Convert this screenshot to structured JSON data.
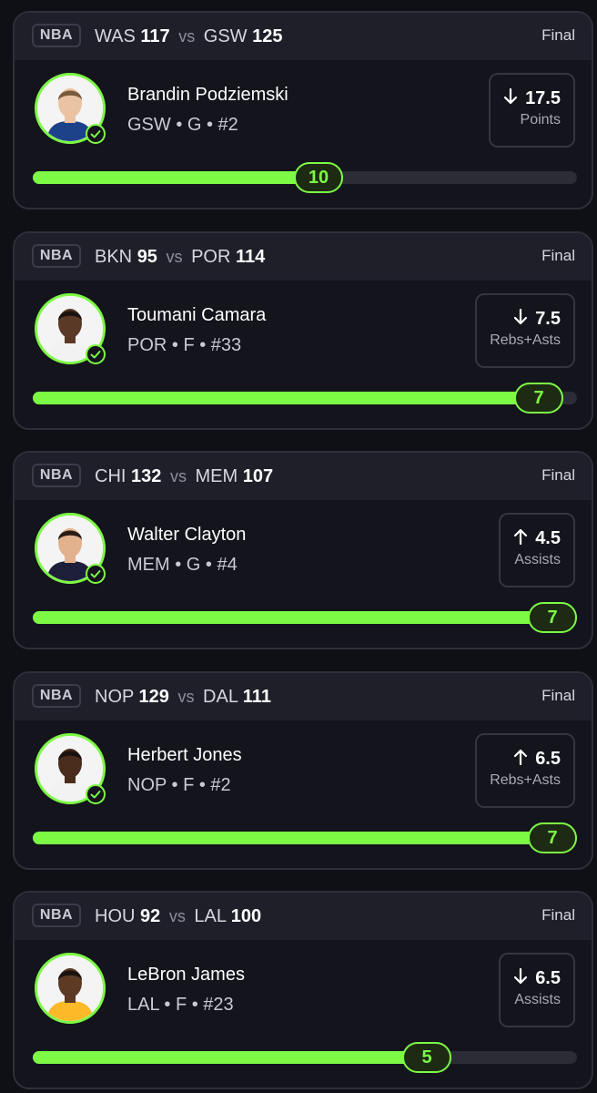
{
  "colors": {
    "accent": "#7dfa45",
    "background": "#0f1016",
    "card": "#13141c",
    "header": "#1e1f29"
  },
  "cards": [
    {
      "league": "NBA",
      "away_team": "WAS",
      "away_score": "117",
      "vs": "vs",
      "home_team": "GSW",
      "home_score": "125",
      "status": "Final",
      "player_name": "Brandin Podziemski",
      "player_meta": "GSW • G • #2",
      "direction": "down",
      "line": "17.5",
      "stat_label": "Points",
      "result": "10",
      "progress": 0.57,
      "check_icon": "check-circle-icon",
      "avatar_skin": "#e9c3a3",
      "avatar_hair": "#7a5a3c",
      "avatar_jersey": "#1d428a",
      "avatar_bg": "#f4f4f4"
    },
    {
      "league": "NBA",
      "away_team": "BKN",
      "away_score": "95",
      "vs": "vs",
      "home_team": "POR",
      "home_score": "114",
      "status": "Final",
      "player_name": "Toumani Camara",
      "player_meta": "POR • F • #33",
      "direction": "down",
      "line": "7.5",
      "stat_label": "Rebs+Asts",
      "result": "7",
      "progress": 0.975,
      "check_icon": "check-circle-icon",
      "avatar_skin": "#5a3a26",
      "avatar_hair": "#1b1310",
      "avatar_jersey": "#f2f2f2",
      "avatar_bg": "#f4f4f4"
    },
    {
      "league": "NBA",
      "away_team": "CHI",
      "away_score": "132",
      "vs": "vs",
      "home_team": "MEM",
      "home_score": "107",
      "status": "Final",
      "player_name": "Walter Clayton",
      "player_meta": "MEM • G • #4",
      "direction": "up",
      "line": "4.5",
      "stat_label": "Assists",
      "result": "7",
      "progress": 1.0,
      "check_icon": "check-circle-icon",
      "avatar_skin": "#e2b28e",
      "avatar_hair": "#2a1c14",
      "avatar_jersey": "#1d1f3a",
      "avatar_bg": "#f4f4f4"
    },
    {
      "league": "NBA",
      "away_team": "NOP",
      "away_score": "129",
      "vs": "vs",
      "home_team": "DAL",
      "home_score": "111",
      "status": "Final",
      "player_name": "Herbert Jones",
      "player_meta": "NOP • F • #2",
      "direction": "up",
      "line": "6.5",
      "stat_label": "Rebs+Asts",
      "result": "7",
      "progress": 1.0,
      "check_icon": "check-circle-icon",
      "avatar_skin": "#4a2c1c",
      "avatar_hair": "#1a1210",
      "avatar_jersey": "#f2f2f2",
      "avatar_bg": "#f4f4f4"
    },
    {
      "league": "NBA",
      "away_team": "HOU",
      "away_score": "92",
      "vs": "vs",
      "home_team": "LAL",
      "home_score": "100",
      "status": "Final",
      "player_name": "LeBron James",
      "player_meta": "LAL • F • #23",
      "direction": "down",
      "line": "6.5",
      "stat_label": "Assists",
      "result": "5",
      "progress": 0.77,
      "check_icon": "",
      "avatar_skin": "#5c3a24",
      "avatar_hair": "#1b1210",
      "avatar_jersey": "#fdb927",
      "avatar_bg": "#f4f4f4"
    }
  ]
}
